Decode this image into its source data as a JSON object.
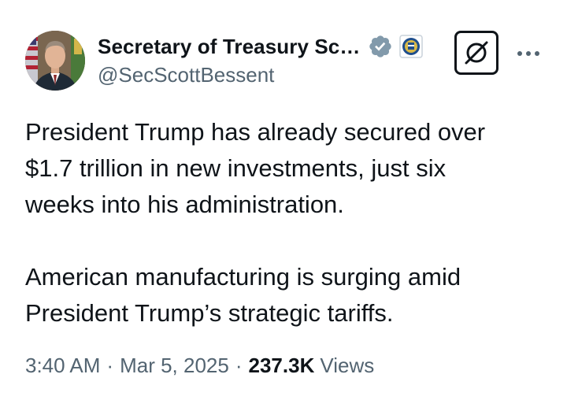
{
  "author": {
    "display_name": "Secretary of Treasury Sc…",
    "handle": "@SecScottBessent"
  },
  "tweet": {
    "lines_p1": [
      "President Trump has already secured over",
      "$1.7 trillion in new investments, just six",
      "weeks into his administration."
    ],
    "lines_p2": [
      "American manufacturing is surging amid",
      "President Trump’s strategic tariffs."
    ]
  },
  "meta": {
    "time": "3:40 AM",
    "separator": "·",
    "date": "Mar 5, 2025",
    "views_count": "237.3K",
    "views_label": "Views"
  },
  "icons": {
    "verified": "verified-badge-icon",
    "affiliation": "treasury-seal-icon",
    "grok": "grok-icon",
    "more": "more-dots-icon"
  },
  "colors": {
    "text_primary": "#0f1419",
    "text_secondary": "#536471",
    "verified_badge": "#829aab"
  }
}
